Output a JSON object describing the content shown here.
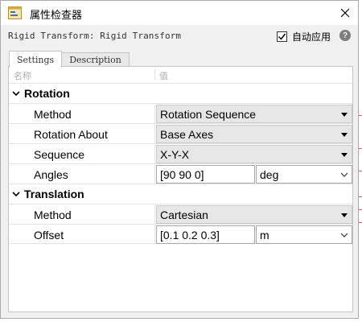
{
  "window": {
    "title": "属性检查器",
    "block_name": "Rigid Transform: Rigid Transform",
    "auto_apply_label": "自动应用",
    "auto_apply_checked": true,
    "help_glyph": "?"
  },
  "tabs": [
    {
      "label": "Settings",
      "active": true
    },
    {
      "label": "Description",
      "active": false
    }
  ],
  "columns": {
    "name": "名称",
    "value": "值"
  },
  "groups": {
    "rotation": {
      "label": "Rotation",
      "method": {
        "label": "Method",
        "value": "Rotation Sequence"
      },
      "rotation_about": {
        "label": "Rotation About",
        "value": "Base Axes"
      },
      "sequence": {
        "label": "Sequence",
        "value": "X-Y-X"
      },
      "angles": {
        "label": "Angles",
        "value": "[90 90 0]",
        "unit": "deg"
      }
    },
    "translation": {
      "label": "Translation",
      "method": {
        "label": "Method",
        "value": "Cartesian"
      },
      "offset": {
        "label": "Offset",
        "value": "[0.1 0.2 0.3]",
        "unit": "m"
      }
    }
  },
  "colors": {
    "window_bg": "#f0f0f0",
    "dropdown_bg": "#e6e6e6",
    "border": "#c4c4c4",
    "help_icon": "#7d7d7d"
  }
}
